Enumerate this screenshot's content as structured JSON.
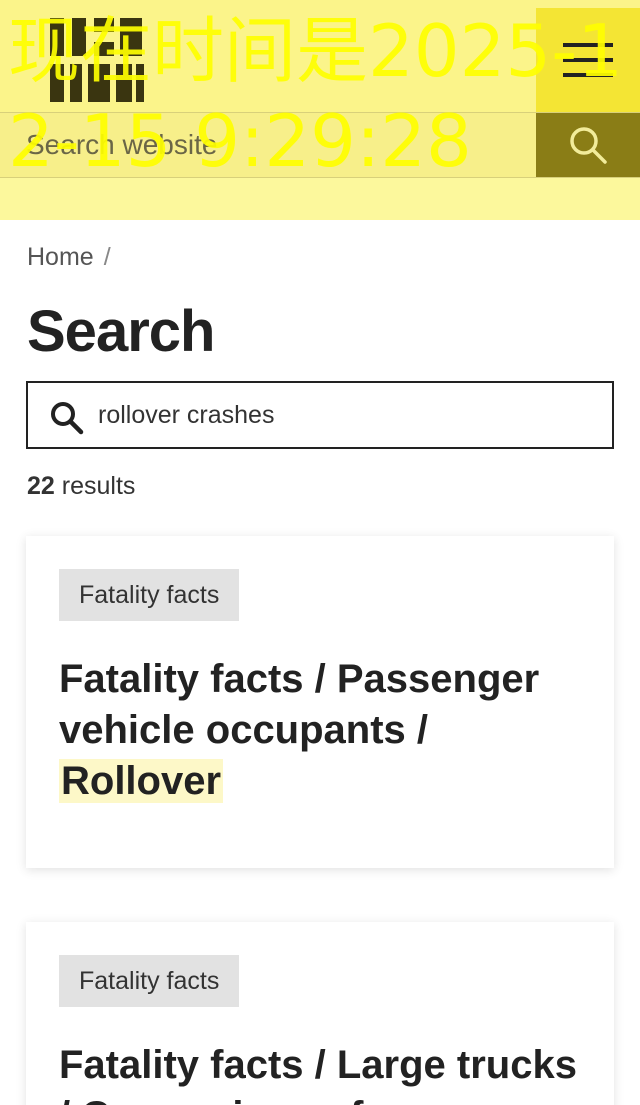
{
  "overlay_clock": "现在时间是2025-12-15 9:29:28",
  "header": {
    "logo_text": "IIHS HLDI",
    "search_placeholder": "Search website"
  },
  "breadcrumb": {
    "home": "Home",
    "separator": "/"
  },
  "page_title": "Search",
  "search": {
    "query": "rollover crashes"
  },
  "results": {
    "count": "22",
    "label": "results",
    "items": [
      {
        "tag": "Fatality facts",
        "title_prefix": "Fatality facts / Passenger vehicle occupants / ",
        "title_highlight": "Rollover"
      },
      {
        "tag": "Fatality facts",
        "title_prefix": "Fatality facts / Large trucks / Comparison of...",
        "title_highlight": ""
      }
    ]
  },
  "colors": {
    "header_bg": "#fbf48a",
    "menu_bg": "#f4e534",
    "search_btn_bg": "#8a7d16",
    "highlight": "#fdf8c8",
    "clock_overlay": "#ffff00"
  }
}
